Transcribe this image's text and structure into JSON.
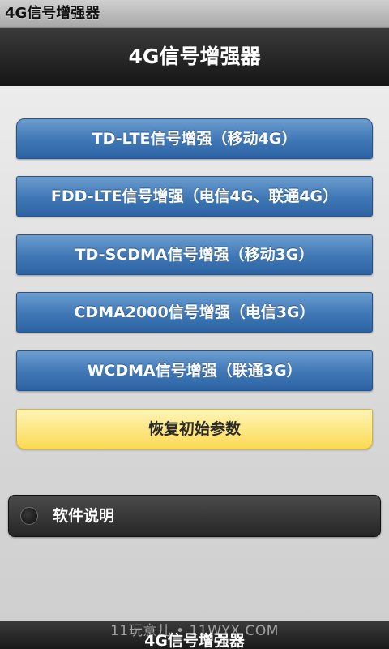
{
  "status_bar": {
    "title": "4G信号增强器"
  },
  "header": {
    "title": "4G信号增强器"
  },
  "buttons": [
    {
      "label": "TD-LTE信号增强（移动4G）"
    },
    {
      "label": "FDD-LTE信号增强（电信4G、联通4G）"
    },
    {
      "label": "TD-SCDMA信号增强（移动3G）"
    },
    {
      "label": "CDMA2000信号增强（电信3G）"
    },
    {
      "label": "WCDMA信号增强（联通3G）"
    }
  ],
  "reset_button": {
    "label": "恢复初始参数"
  },
  "help": {
    "label": "软件说明",
    "checked": false
  },
  "footer": {
    "title": "4G信号增强器",
    "watermark": "11玩意儿 • 11WYX.COM"
  },
  "colors": {
    "button_blue": "#3f77b5",
    "button_yellow": "#fde98a",
    "header_bg": "#1f1f1f"
  }
}
